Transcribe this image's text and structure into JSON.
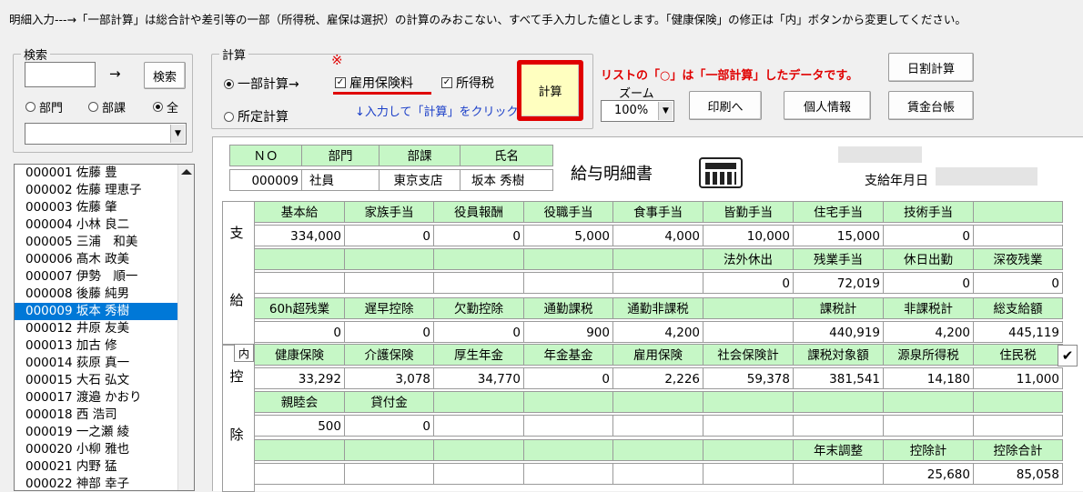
{
  "info_text": "明細入力---→「一部計算」は総合計や差引等の一部（所得税、雇保は選択）の計算のみおこない、すべて手入力した値とします。「健康保険」の修正は「内」ボタンから変更してください。",
  "search": {
    "legend": "検索",
    "arrow": "→",
    "button": "検索",
    "radios": [
      {
        "label": "部門",
        "checked": false
      },
      {
        "label": "部課",
        "checked": false
      },
      {
        "label": "全",
        "checked": true
      }
    ]
  },
  "calc": {
    "legend": "計算",
    "partial_label": "一部計算→",
    "partial_checked": true,
    "fixed_label": "所定計算",
    "fixed_checked": false,
    "mark": "※",
    "koyou_label": "雇用保険料",
    "koyou_checked": true,
    "shotoku_label": "所得税",
    "shotoku_checked": true,
    "hint": "↓入力して「計算」をクリック ⇒",
    "button": "計算"
  },
  "note_red": "リストの「○」は「一部計算」したデータです。",
  "zoom": {
    "label": "ズーム",
    "value": "100%"
  },
  "buttons": {
    "print": "印刷へ",
    "personal": "個人情報",
    "daily": "日割計算",
    "ledger": "賃金台帳",
    "uchi": "内"
  },
  "employees": [
    {
      "id": "000001",
      "name": "佐藤 豊"
    },
    {
      "id": "000002",
      "name": "佐藤 理恵子"
    },
    {
      "id": "000003",
      "name": "佐藤 肇"
    },
    {
      "id": "000004",
      "name": "小林 良二"
    },
    {
      "id": "000005",
      "name": "三浦　和美"
    },
    {
      "id": "000006",
      "name": "髙木 政美"
    },
    {
      "id": "000007",
      "name": "伊勢　順一"
    },
    {
      "id": "000008",
      "name": "後藤 純男"
    },
    {
      "id": "000009",
      "name": "坂本 秀樹"
    },
    {
      "id": "000012",
      "name": "井原 友美"
    },
    {
      "id": "000013",
      "name": "加古 修"
    },
    {
      "id": "000014",
      "name": "荻原 真一"
    },
    {
      "id": "000015",
      "name": "大石 弘文"
    },
    {
      "id": "000017",
      "name": "渡邉 かおり"
    },
    {
      "id": "000018",
      "name": "西 浩司"
    },
    {
      "id": "000019",
      "name": "一之瀬 綾"
    },
    {
      "id": "000020",
      "name": "小柳 雅也"
    },
    {
      "id": "000021",
      "name": "内野 猛"
    },
    {
      "id": "000022",
      "name": "神部 幸子"
    }
  ],
  "selected_employee": "000009",
  "header": {
    "labels": [
      "ＮＯ",
      "部門",
      "部課",
      "氏名"
    ],
    "values": [
      "000009",
      "社員",
      "東京支店",
      "坂本 秀樹"
    ]
  },
  "title": "給与明細書",
  "payday_label": "支給年月日",
  "section_labels": {
    "shi": "支",
    "kyu": "給",
    "kou": "控",
    "jo": "除"
  },
  "payments": {
    "row1_labels": [
      "基本給",
      "家族手当",
      "役員報酬",
      "役職手当",
      "食事手当",
      "皆勤手当",
      "住宅手当",
      "技術手当",
      ""
    ],
    "row1_values": [
      "334,000",
      "0",
      "0",
      "5,000",
      "4,000",
      "10,000",
      "15,000",
      "0",
      ""
    ],
    "row2_labels": [
      "",
      "",
      "",
      "",
      "",
      "法外休出",
      "残業手当",
      "休日出勤",
      "深夜残業"
    ],
    "row2_values": [
      "",
      "",
      "",
      "",
      "",
      "0",
      "72,019",
      "0",
      "0"
    ],
    "row3_labels": [
      "60h超残業",
      "遅早控除",
      "欠勤控除",
      "通勤課税",
      "通勤非課税",
      "",
      "課税計",
      "非課税計",
      "総支給額"
    ],
    "row3_values": [
      "0",
      "0",
      "0",
      "900",
      "4,200",
      "",
      "440,919",
      "4,200",
      "445,119"
    ]
  },
  "deductions": {
    "row1_labels": [
      "健康保険",
      "介護保険",
      "厚生年金",
      "年金基金",
      "雇用保険",
      "社会保険計",
      "課税対象額",
      "源泉所得税",
      "住民税"
    ],
    "row1_values": [
      "33,292",
      "3,078",
      "34,770",
      "0",
      "2,226",
      "59,378",
      "381,541",
      "14,180",
      "11,000"
    ],
    "row2_labels": [
      "親睦会",
      "貸付金",
      "",
      "",
      "",
      "",
      "",
      "",
      ""
    ],
    "row2_values": [
      "500",
      "0",
      "",
      "",
      "",
      "",
      "",
      "",
      ""
    ],
    "row3_labels": [
      "",
      "",
      "",
      "",
      "",
      "",
      "年末調整",
      "控除計",
      "控除合計"
    ],
    "row3_values": [
      "",
      "",
      "",
      "",
      "",
      "",
      "",
      "25,680",
      "85,058"
    ]
  },
  "checkmark": "✔",
  "colors": {
    "highlight_red": "#e00000",
    "header_green": "#c6f7c6",
    "calc_button_bg": "#ffffc0",
    "selected_row": "#0078d7"
  }
}
